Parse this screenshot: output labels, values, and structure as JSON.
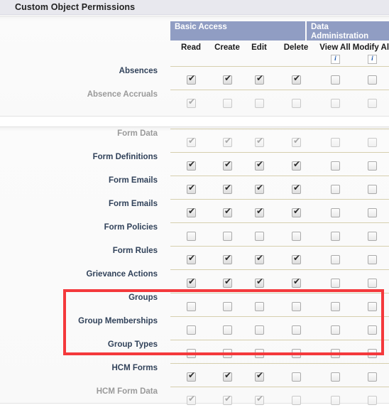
{
  "section": {
    "title": "Custom Object Permissions"
  },
  "table": {
    "group_headers": [
      {
        "id": "basic-access",
        "label": "Basic Access",
        "label_line2": ""
      },
      {
        "id": "data-administration",
        "label": "Data",
        "label_line2": "Administration"
      }
    ],
    "columns": [
      {
        "id": "read",
        "label": "Read",
        "info": false
      },
      {
        "id": "create",
        "label": "Create",
        "info": false
      },
      {
        "id": "edit",
        "label": "Edit",
        "info": false
      },
      {
        "id": "delete",
        "label": "Delete",
        "info": false
      },
      {
        "id": "view-all",
        "label": "View All",
        "info": true,
        "info_glyph": "i"
      },
      {
        "id": "modify-all",
        "label": "Modify All",
        "info": true,
        "info_glyph": "i"
      }
    ],
    "check_glyph": "✔",
    "groups": [
      {
        "id": "group-1",
        "rows": [
          {
            "label": "Absences",
            "disabled": false,
            "values": [
              true,
              true,
              true,
              true,
              false,
              false
            ]
          },
          {
            "label": "Absence Accruals",
            "disabled": true,
            "values": [
              true,
              false,
              false,
              false,
              false,
              false
            ]
          }
        ]
      },
      {
        "id": "group-2",
        "rows": [
          {
            "label": "Form Data",
            "disabled": true,
            "values": [
              true,
              true,
              true,
              true,
              false,
              false
            ]
          },
          {
            "label": "Form Definitions",
            "disabled": false,
            "values": [
              true,
              true,
              true,
              true,
              false,
              false
            ]
          },
          {
            "label": "Form Emails",
            "disabled": false,
            "values": [
              true,
              true,
              true,
              true,
              false,
              false
            ]
          },
          {
            "label": "Form Emails",
            "disabled": false,
            "values": [
              true,
              true,
              true,
              true,
              false,
              false
            ]
          },
          {
            "label": "Form Policies",
            "disabled": false,
            "values": [
              false,
              false,
              false,
              false,
              false,
              false
            ]
          },
          {
            "label": "Form Rules",
            "disabled": false,
            "values": [
              true,
              true,
              true,
              true,
              false,
              false
            ]
          },
          {
            "label": "Grievance Actions",
            "disabled": false,
            "values": [
              true,
              true,
              true,
              true,
              false,
              false
            ]
          },
          {
            "label": "Groups",
            "disabled": false,
            "values": [
              false,
              false,
              false,
              false,
              false,
              false
            ]
          },
          {
            "label": "Group Memberships",
            "disabled": false,
            "values": [
              false,
              false,
              false,
              false,
              false,
              false
            ]
          },
          {
            "label": "Group Types",
            "disabled": false,
            "values": [
              false,
              false,
              false,
              false,
              false,
              false
            ]
          },
          {
            "label": "HCM Forms",
            "disabled": false,
            "values": [
              true,
              true,
              true,
              false,
              false,
              false
            ]
          },
          {
            "label": "HCM Form Data",
            "disabled": true,
            "values": [
              true,
              true,
              true,
              false,
              false,
              false
            ]
          }
        ]
      }
    ]
  },
  "annotation": {
    "id": "red-highlight",
    "color": "#f4393c",
    "covers_rows": [
      "Groups",
      "Group Memberships",
      "Group Types"
    ]
  },
  "colors": {
    "header_band": "#909dc3",
    "title_bar": "#e8e8ee",
    "row_rule": "#d6cfae",
    "label_text": "#31425a",
    "disabled_text": "#9a9a9a",
    "info_text": "#1a54a8"
  }
}
